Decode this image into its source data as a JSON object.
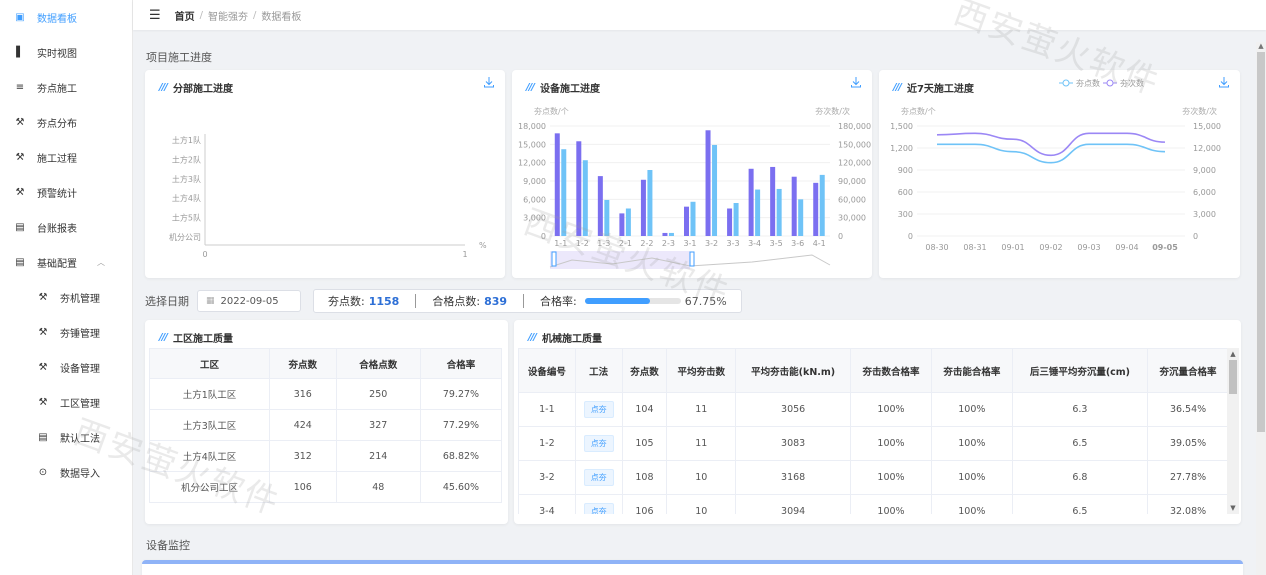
{
  "sidebar": {
    "items": [
      {
        "label": "数据看板",
        "icon": "dashboard-icon",
        "active": true
      },
      {
        "label": "实时视图",
        "icon": "bar-chart-icon"
      },
      {
        "label": "夯点施工",
        "icon": "list-icon"
      },
      {
        "label": "夯点分布",
        "icon": "hammer-icon"
      },
      {
        "label": "施工过程",
        "icon": "hammer-icon"
      },
      {
        "label": "预警统计",
        "icon": "hammer-icon"
      },
      {
        "label": "台账报表",
        "icon": "report-icon"
      },
      {
        "label": "基础配置",
        "icon": "report-icon",
        "expanded": true
      }
    ],
    "sub_items": [
      {
        "label": "夯机管理",
        "icon": "hammer-icon"
      },
      {
        "label": "夯锤管理",
        "icon": "hammer-icon"
      },
      {
        "label": "设备管理",
        "icon": "hammer-icon"
      },
      {
        "label": "工区管理",
        "icon": "hammer-icon"
      },
      {
        "label": "默认工法",
        "icon": "report-icon"
      },
      {
        "label": "数据导入",
        "icon": "import-icon"
      }
    ]
  },
  "breadcrumb": [
    "首页",
    "智能强夯",
    "数据看板"
  ],
  "sections": {
    "progress": "项目施工进度",
    "monitor": "设备监控"
  },
  "cards": {
    "division": "分部施工进度",
    "equipment": "设备施工进度",
    "recent": "近7天施工进度",
    "quality_zone": "工区施工质量",
    "quality_machine": "机械施工质量"
  },
  "division_chart": {
    "categories": [
      "土方1队",
      "土方2队",
      "土方3队",
      "土方4队",
      "土方5队",
      "机分公司"
    ],
    "x_ticks": [
      "0",
      "1"
    ],
    "unit": "%"
  },
  "filter": {
    "date_label": "选择日期",
    "date_value": "2022-09-05",
    "ram_label": "夯点数:",
    "ram_value": "1158",
    "qualified_label": "合格点数:",
    "qualified_value": "839",
    "rate_label": "合格率:",
    "rate_value": "67.75%",
    "rate_fraction": 0.6775
  },
  "zone_table": {
    "headers": [
      "工区",
      "夯点数",
      "合格点数",
      "合格率"
    ],
    "rows": [
      [
        "土方1队工区",
        "316",
        "250",
        "79.27%"
      ],
      [
        "土方3队工区",
        "424",
        "327",
        "77.29%"
      ],
      [
        "土方4队工区",
        "312",
        "214",
        "68.82%"
      ],
      [
        "机分公司工区",
        "106",
        "48",
        "45.60%"
      ]
    ]
  },
  "machine_table": {
    "headers": [
      "设备编号",
      "工法",
      "夯点数",
      "平均夯击数",
      "平均夯击能(kN.m)",
      "夯击数合格率",
      "夯击能合格率",
      "后三锤平均夯沉量(cm)",
      "夯沉量合格率"
    ],
    "rows": [
      [
        "1-1",
        "点夯",
        "104",
        "11",
        "3056",
        "100%",
        "100%",
        "6.3",
        "36.54%"
      ],
      [
        "1-2",
        "点夯",
        "105",
        "11",
        "3083",
        "100%",
        "100%",
        "6.5",
        "39.05%"
      ],
      [
        "3-2",
        "点夯",
        "108",
        "10",
        "3168",
        "100%",
        "100%",
        "6.8",
        "27.78%"
      ],
      [
        "3-4",
        "点夯",
        "106",
        "10",
        "3094",
        "100%",
        "100%",
        "6.5",
        "32.08%"
      ]
    ]
  },
  "watermark": "西安萤火软件",
  "colors": {
    "accent": "#409eff",
    "purple": "#7b6ff0",
    "lightblue": "#6fc3f7"
  },
  "chart_data": [
    {
      "type": "bar",
      "title": "分部施工进度",
      "categories": [
        "土方1队",
        "土方2队",
        "土方3队",
        "土方4队",
        "土方5队",
        "机分公司"
      ],
      "values": [],
      "xlim": [
        0,
        1
      ],
      "xlabel": "%"
    },
    {
      "type": "bar",
      "title": "设备施工进度",
      "ylabel_left": "夯点数/个",
      "ylabel_right": "夯次数/次",
      "ylim_left": [
        0,
        18000
      ],
      "ylim_right": [
        0,
        180000
      ],
      "y_ticks_left": [
        "0",
        "3,000",
        "6,000",
        "9,000",
        "12,000",
        "15,000",
        "18,000"
      ],
      "y_ticks_right": [
        "0",
        "30,000",
        "60,000",
        "90,000",
        "120,000",
        "150,000",
        "180,000"
      ],
      "categories": [
        "1-1",
        "1-2",
        "1-3",
        "2-1",
        "2-2",
        "2-3",
        "3-1",
        "3-2",
        "3-3",
        "3-4",
        "3-5",
        "3-6",
        "4-1"
      ],
      "series": [
        {
          "name": "夯点数",
          "axis": "left",
          "values": [
            16800,
            15500,
            9800,
            3700,
            9200,
            500,
            4800,
            17300,
            4500,
            11000,
            11300,
            9700,
            8700
          ]
        },
        {
          "name": "夯次数",
          "axis": "right",
          "values": [
            142000,
            124000,
            59000,
            45000,
            108000,
            5000,
            56000,
            149000,
            54000,
            76000,
            77000,
            60000,
            100000
          ]
        }
      ]
    },
    {
      "type": "line",
      "title": "近7天施工进度",
      "ylabel_left": "夯点数/个",
      "ylabel_right": "夯次数/次",
      "ylim_left": [
        0,
        1500
      ],
      "ylim_right": [
        0,
        15000
      ],
      "y_ticks_left": [
        "0",
        "300",
        "600",
        "900",
        "1,200",
        "1,500"
      ],
      "y_ticks_right": [
        "0",
        "3,000",
        "6,000",
        "9,000",
        "12,000",
        "15,000"
      ],
      "x": [
        "08-30",
        "08-31",
        "09-01",
        "09-02",
        "09-03",
        "09-04",
        "09-05"
      ],
      "series": [
        {
          "name": "夯点数",
          "values": [
            1250,
            1250,
            1150,
            1000,
            1250,
            1250,
            1150
          ]
        },
        {
          "name": "夯次数",
          "values": [
            13800,
            14000,
            13200,
            11000,
            14000,
            14000,
            12800
          ]
        }
      ]
    }
  ]
}
